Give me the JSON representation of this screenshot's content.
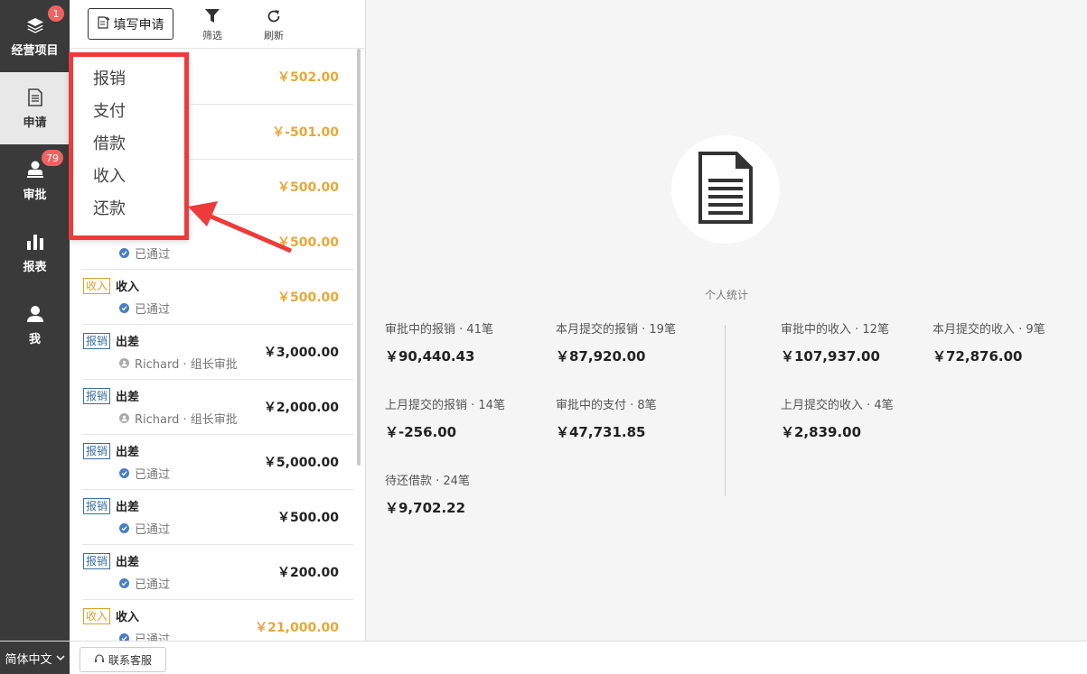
{
  "sidebar": {
    "items": [
      {
        "label": "经营项目",
        "icon": "layers-icon",
        "badge": "1"
      },
      {
        "label": "申请",
        "icon": "document-icon",
        "badge": ""
      },
      {
        "label": "审批",
        "icon": "stamp-icon",
        "badge": "79"
      },
      {
        "label": "报表",
        "icon": "bar-chart-icon",
        "badge": ""
      },
      {
        "label": "我",
        "icon": "user-icon",
        "badge": ""
      }
    ],
    "language": "简体中文"
  },
  "toolbar": {
    "fill_label": "填写申请",
    "filter_label": "筛选",
    "refresh_label": "刷新"
  },
  "menu": {
    "items": [
      "报销",
      "支付",
      "借款",
      "收入",
      "还款"
    ]
  },
  "list": {
    "rows": [
      {
        "tag": "",
        "title": "",
        "status": "",
        "amount": "￥502.00",
        "color": "#e8a838"
      },
      {
        "tag": "",
        "title": "",
        "status": "",
        "amount": "￥-501.00",
        "color": "#e8a838"
      },
      {
        "tag": "",
        "title": "",
        "status": "",
        "amount": "￥500.00",
        "color": "#e8a838"
      },
      {
        "tag": "",
        "title": "",
        "status": "已通过",
        "amount": "￥500.00",
        "color": "#e8a838"
      },
      {
        "tag": "收入",
        "title": "收入",
        "status": "已通过",
        "amount": "￥500.00",
        "color": "#e8a838"
      },
      {
        "tag": "报销",
        "title": "出差",
        "status": "Richard · 组长审批",
        "amount": "￥3,000.00",
        "color": "#222222"
      },
      {
        "tag": "报销",
        "title": "出差",
        "status": "Richard · 组长审批",
        "amount": "￥2,000.00",
        "color": "#222222"
      },
      {
        "tag": "报销",
        "title": "出差",
        "status": "已通过",
        "amount": "￥5,000.00",
        "color": "#222222"
      },
      {
        "tag": "报销",
        "title": "出差",
        "status": "已通过",
        "amount": "￥500.00",
        "color": "#222222"
      },
      {
        "tag": "报销",
        "title": "出差",
        "status": "已通过",
        "amount": "￥200.00",
        "color": "#222222"
      },
      {
        "tag": "收入",
        "title": "收入",
        "status": "已通过",
        "amount": "￥21,000.00",
        "color": "#e8a838"
      }
    ]
  },
  "stats": {
    "title": "个人统计",
    "items": [
      {
        "label": "审批中的报销 · 41笔",
        "value": "￥90,440.43"
      },
      {
        "label": "本月提交的报销 · 19笔",
        "value": "￥87,920.00"
      },
      {
        "label": "上月提交的报销 · 14笔",
        "value": "￥-256.00"
      },
      {
        "label": "审批中的支付 · 8笔",
        "value": "￥47,731.85"
      },
      {
        "label": "待还借款 · 24笔",
        "value": "￥9,702.22"
      },
      {
        "label": "审批中的收入 · 12笔",
        "value": "￥107,937.00"
      },
      {
        "label": "本月提交的收入 · 9笔",
        "value": "￥72,876.00"
      },
      {
        "label": "上月提交的收入 · 4笔",
        "value": "￥2,839.00"
      }
    ]
  },
  "bottom": {
    "support_label": "联系客服"
  },
  "colors": {
    "sidebar_bg": "#3a3a3a",
    "badge": "#f06262",
    "menu_border": "#ee3a3a",
    "income_orange": "#e8a838",
    "reimburse_blue": "#3a6ea5"
  }
}
